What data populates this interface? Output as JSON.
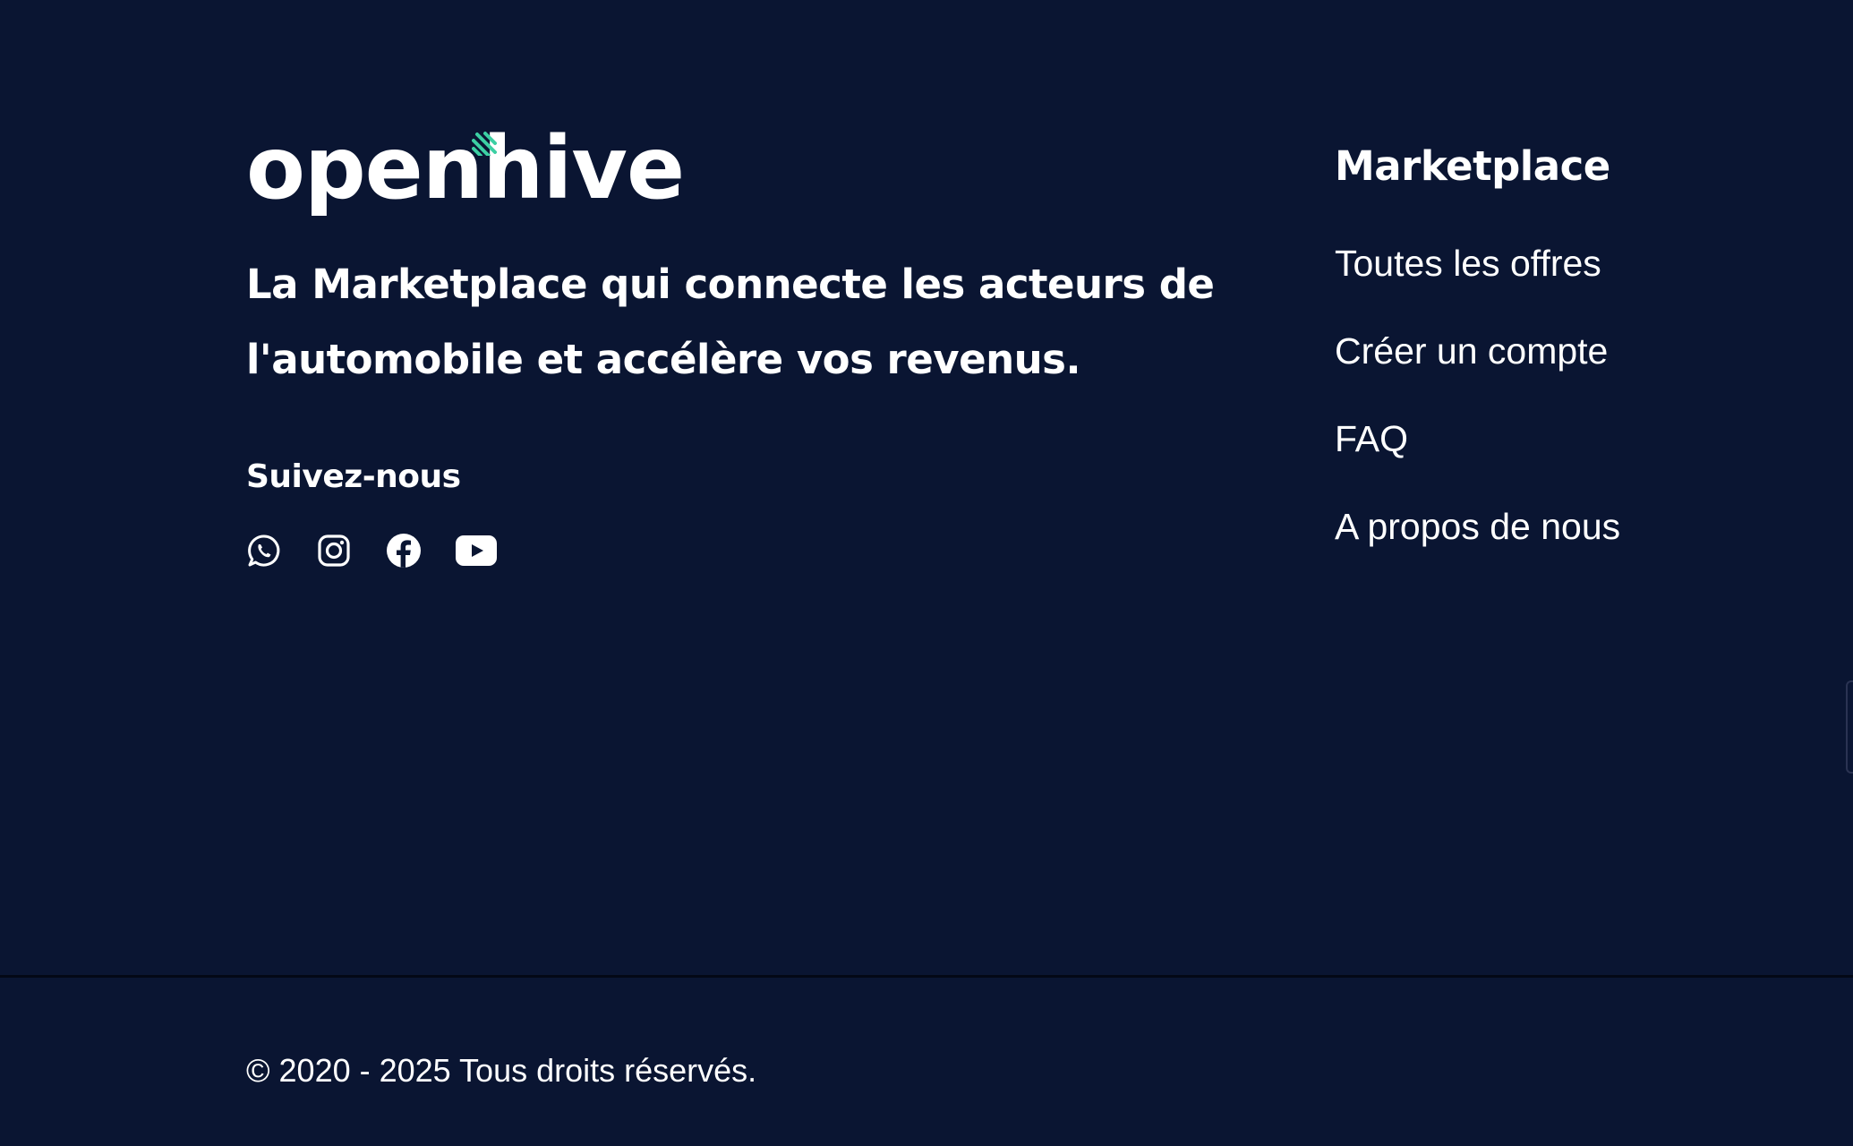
{
  "brand": {
    "logo_text": "openhive",
    "tagline": "La Marketplace qui connecte les acteurs de l'automobile et accélère vos revenus.",
    "accent_color": "#3ccfa3"
  },
  "social": {
    "title": "Suivez-nous",
    "icons": [
      "whatsapp-icon",
      "instagram-icon",
      "facebook-icon",
      "youtube-icon"
    ]
  },
  "marketplace": {
    "title": "Marketplace",
    "links": [
      {
        "label": "Toutes les offres"
      },
      {
        "label": "Créer un compte"
      },
      {
        "label": "FAQ"
      },
      {
        "label": "A propos de nous"
      }
    ]
  },
  "footer": {
    "copyright": "© 2020 - 2025 Tous droits réservés."
  },
  "colors": {
    "background": "#0a1532",
    "text": "#ffffff",
    "divider": "#030816"
  }
}
